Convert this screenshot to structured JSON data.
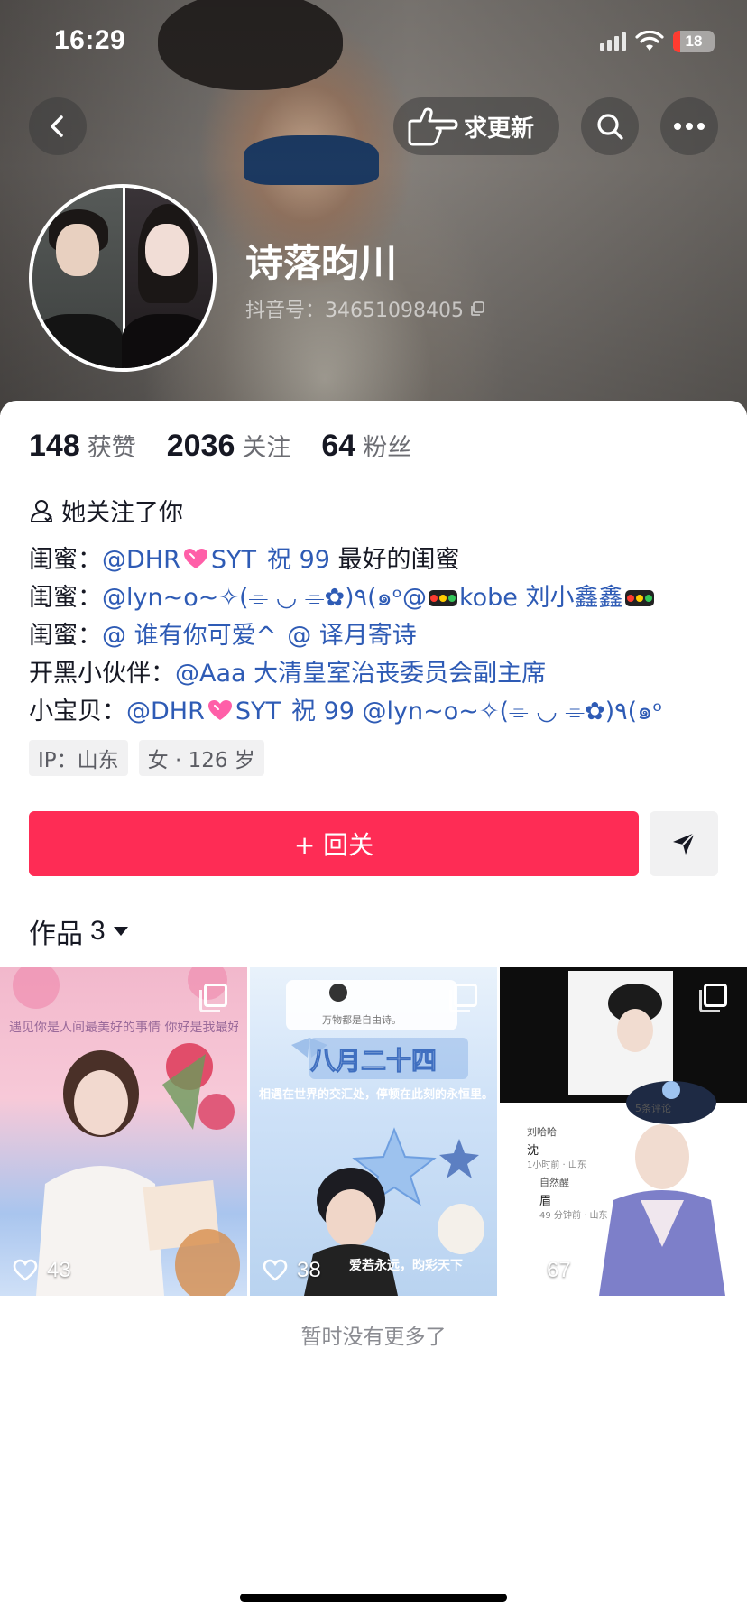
{
  "status_bar": {
    "time": "16:29",
    "battery": "18",
    "battery_level_percent": 18
  },
  "nav": {
    "back_icon": "chevron-left-icon",
    "update_label": "求更新",
    "update_icon": "pointing-hand-icon",
    "search_icon": "search-icon",
    "more_icon": "more-dots-icon"
  },
  "profile": {
    "nickname": "诗落昀川",
    "douyin_id": "抖音号：34651098405",
    "copy_icon": "copy-icon"
  },
  "stats": [
    {
      "num": "148",
      "label": "获赞"
    },
    {
      "num": "2036",
      "label": "关注"
    },
    {
      "num": "64",
      "label": "粉丝"
    }
  ],
  "follow_note": "她关注了你",
  "bio": {
    "line1": {
      "prefix": "闺蜜：",
      "m1a": "@DHR",
      "m1b": "SYT",
      "rest": "祝 99",
      "tail": "最好的闺蜜"
    },
    "line2": {
      "prefix": "闺蜜：",
      "m1a": "@lyn~o~✧(⌯ ◡ ⌯✿)٩(๑ᵒ@",
      "m1b": "kobe 刘小鑫鑫"
    },
    "line3": {
      "prefix": "闺蜜：",
      "m1": "@ 谁有你可爱^",
      "m2": "@ 译月寄诗"
    },
    "line4": {
      "prefix": "开黑小伙伴：",
      "m1": "@Aaa 大清皇室治丧委员会副主席"
    },
    "line5": {
      "prefix": "小宝贝：",
      "m1a": "@DHR",
      "m1b": "SYT",
      "rest": "祝 99",
      "m2": "@lyn~o~✧(⌯ ◡ ⌯✿)٩(๑ᵒ"
    }
  },
  "tags": [
    "IP：山东",
    "女 · 126 岁"
  ],
  "actions": {
    "follow_back": "+ 回关",
    "share_icon": "send-icon"
  },
  "works": {
    "label": "作品",
    "count": "3"
  },
  "videos": [
    {
      "likes": "43",
      "caption": "遇见你是人间最美好的事情 你好是我最好的"
    },
    {
      "likes": "38",
      "title": "八月二十四",
      "subtitle": "相遇在世界的交汇处，停顿在此刻的永恒里。",
      "bottom": "爱若永远，昀彩天下",
      "note": "万物都是自由诗。"
    },
    {
      "likes": "67",
      "comment_user": "刘哈哈",
      "comment_text": "沈",
      "comment_meta": "1小时前 · 山东",
      "reply_user": "自然醒",
      "reply_text": "眉",
      "reply_meta": "49 分钟前 · 山东",
      "replies_label": "5条评论"
    }
  ],
  "end_note": "暂时没有更多了"
}
